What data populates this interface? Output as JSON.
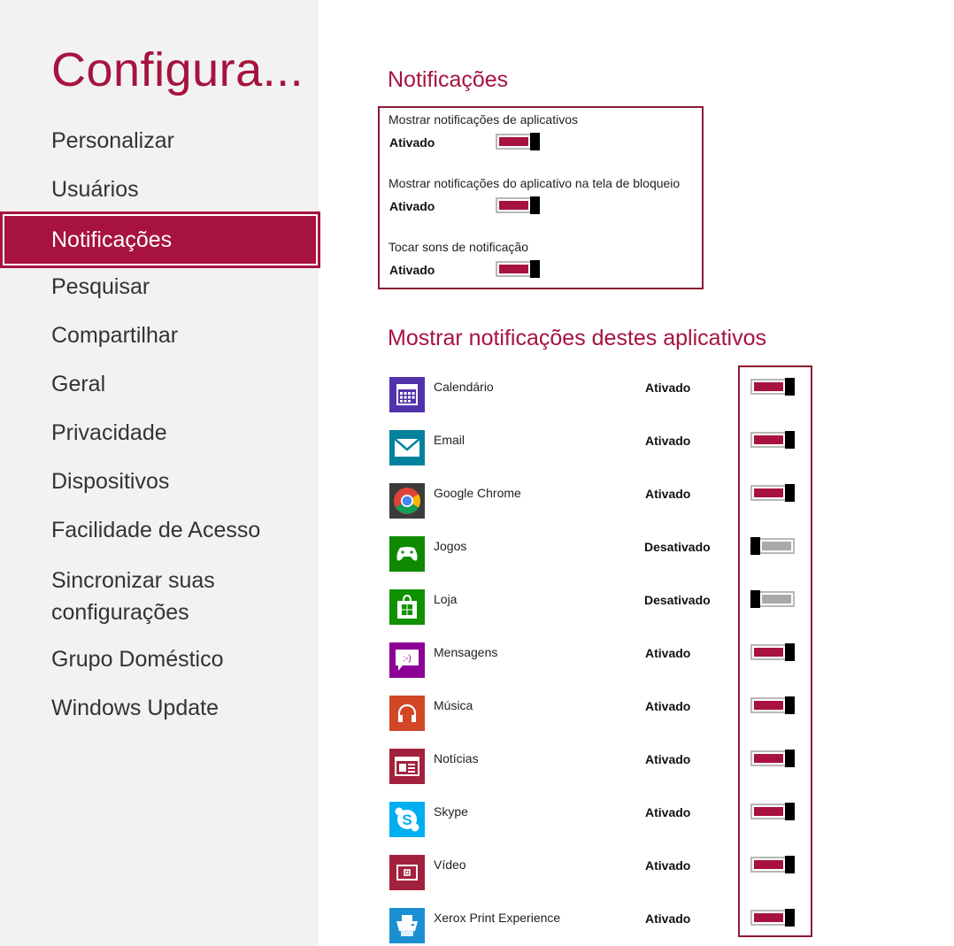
{
  "sidebar": {
    "title": "Configura...",
    "items": [
      {
        "label": "Personalizar"
      },
      {
        "label": "Usuários"
      },
      {
        "label": "Notificações"
      },
      {
        "label": "Pesquisar"
      },
      {
        "label": "Compartilhar"
      },
      {
        "label": "Geral"
      },
      {
        "label": "Privacidade"
      },
      {
        "label": "Dispositivos"
      },
      {
        "label": "Facilidade de Acesso"
      },
      {
        "label": "Sincronizar suas configurações"
      },
      {
        "label": "Grupo Doméstico"
      },
      {
        "label": "Windows Update"
      }
    ],
    "selected_index": 2
  },
  "notifications": {
    "title": "Notificações",
    "settings": [
      {
        "label": "Mostrar notificações de aplicativos",
        "state": "Ativado",
        "on": true
      },
      {
        "label": "Mostrar notificações do aplicativo na tela de bloqueio",
        "state": "Ativado",
        "on": true
      },
      {
        "label": "Tocar sons de notificação",
        "state": "Ativado",
        "on": true
      }
    ]
  },
  "apps_section": {
    "title": "Mostrar notificações destes aplicativos",
    "apps": [
      {
        "name": "Calendário",
        "state": "Ativado",
        "on": true,
        "icon": "calendar-icon",
        "color": "#5133ab"
      },
      {
        "name": "Email",
        "state": "Ativado",
        "on": true,
        "icon": "mail-icon",
        "color": "#00819c"
      },
      {
        "name": "Google Chrome",
        "state": "Ativado",
        "on": true,
        "icon": "chrome-icon",
        "color": "#3b3b3b"
      },
      {
        "name": "Jogos",
        "state": "Desativado",
        "on": false,
        "icon": "xbox-controller-icon",
        "color": "#0f8a00"
      },
      {
        "name": "Loja",
        "state": "Desativado",
        "on": false,
        "icon": "store-icon",
        "color": "#109100"
      },
      {
        "name": "Mensagens",
        "state": "Ativado",
        "on": true,
        "icon": "messaging-icon",
        "color": "#8c0095"
      },
      {
        "name": "Música",
        "state": "Ativado",
        "on": true,
        "icon": "headphones-icon",
        "color": "#d24726"
      },
      {
        "name": "Notícias",
        "state": "Ativado",
        "on": true,
        "icon": "news-icon",
        "color": "#a2213d"
      },
      {
        "name": "Skype",
        "state": "Ativado",
        "on": true,
        "icon": "skype-icon",
        "color": "#00aff0"
      },
      {
        "name": "Vídeo",
        "state": "Ativado",
        "on": true,
        "icon": "video-icon",
        "color": "#a2213d"
      },
      {
        "name": "Xerox Print Experience",
        "state": "Ativado",
        "on": true,
        "icon": "printer-icon",
        "color": "#1a8fd1"
      }
    ]
  },
  "colors": {
    "accent": "#a7133e",
    "sidebar_bg": "#f2f2f2",
    "highlight_border": "#8d1a33",
    "toggle_off": "#a9a9a9"
  }
}
